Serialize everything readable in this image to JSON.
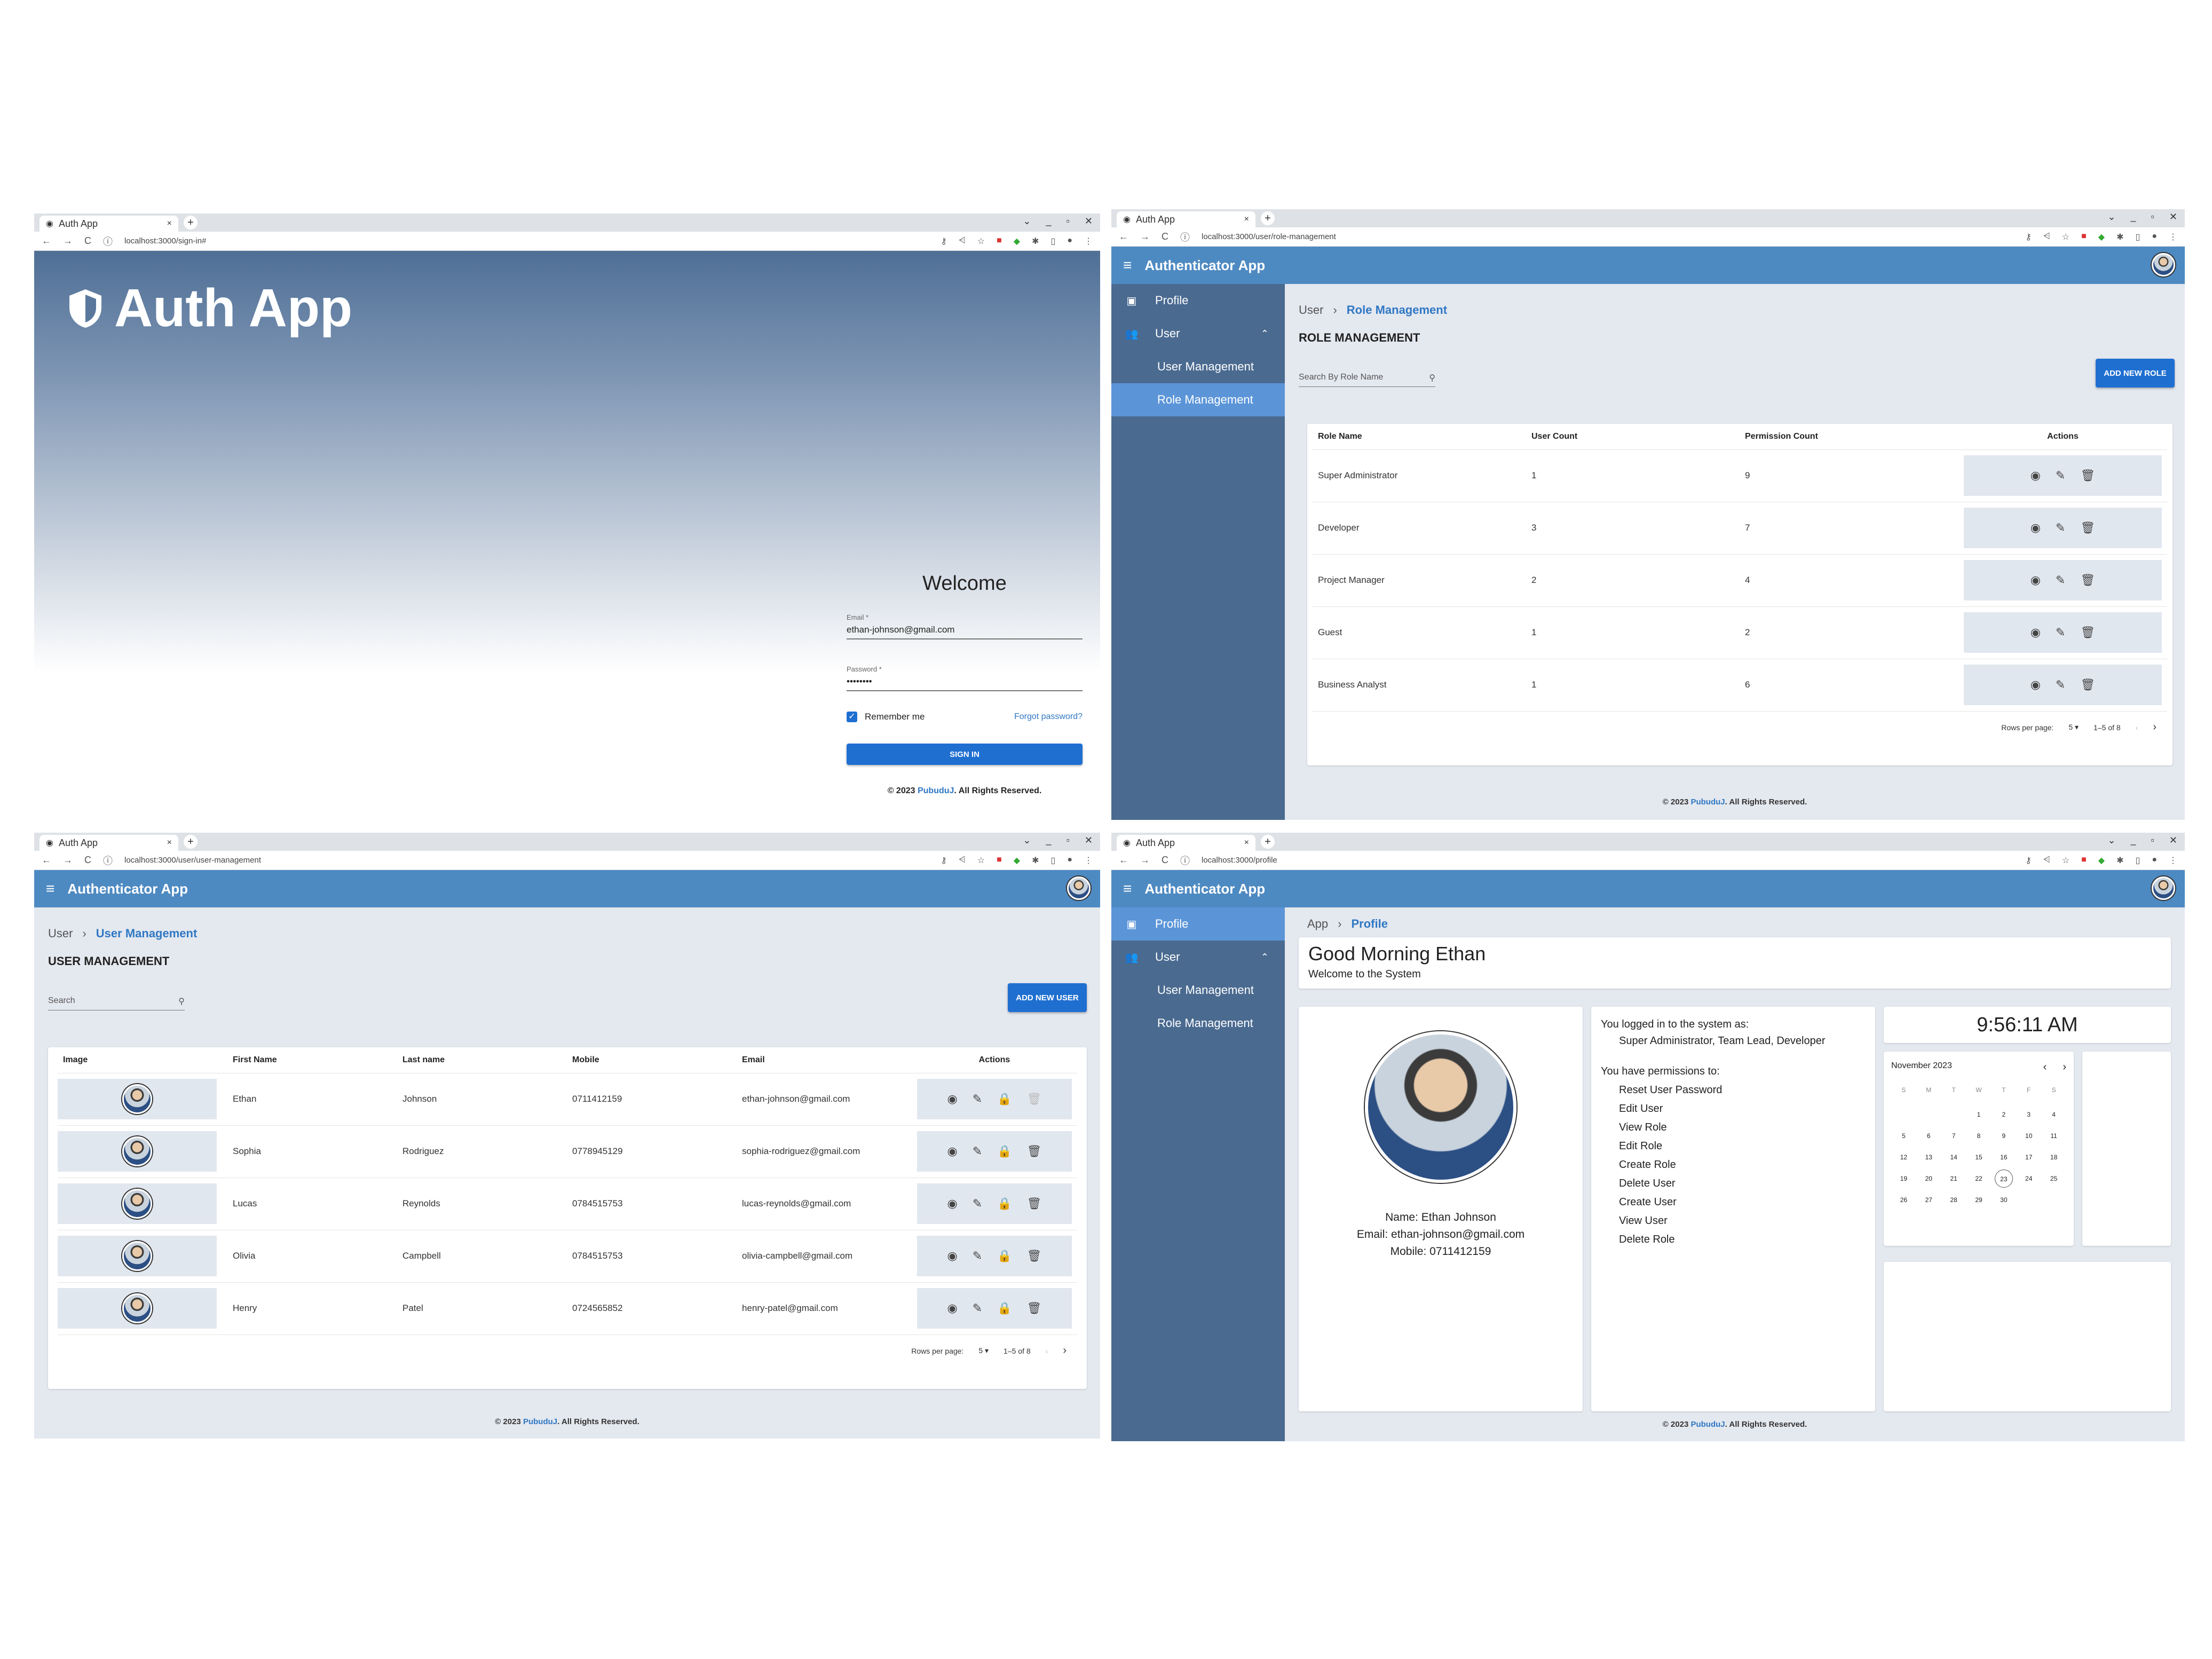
{
  "browser": {
    "tab_title": "Auth App",
    "new_tab": "+",
    "close": "×",
    "controls": [
      "⌄",
      "_",
      "▫",
      "✕"
    ],
    "back": "←",
    "forward": "→",
    "reload": "C",
    "info": "ⓘ"
  },
  "colors": {
    "appbar": "#4e8ac2",
    "sidebar": "#4a6a90",
    "sidebar_active": "#5b95d8",
    "primary_button": "#1f6fd1",
    "link": "#2f78c4"
  },
  "footer": {
    "pre": "© 2023 ",
    "link": "PubuduJ",
    "post": ". All Rights Reserved."
  },
  "signin": {
    "url": "localhost:3000/sign-in#",
    "brand": "Auth App",
    "welcome": "Welcome",
    "email_label": "Email *",
    "email_value": "ethan-johnson@gmail.com",
    "password_label": "Password *",
    "password_value": "••••••••",
    "remember_label": "Remember me",
    "remember_checked": true,
    "forgot": "Forgot password?",
    "submit": "SIGN IN"
  },
  "app": {
    "title": "Authenticator App",
    "menu_icon": "≡",
    "sidebar": {
      "profile": "Profile",
      "user": "User",
      "user_management": "User Management",
      "role_management": "Role Management"
    }
  },
  "roles_page": {
    "url": "localhost:3000/user/role-management",
    "crumb_parent": "User",
    "crumb_sep": "›",
    "crumb_current": "Role Management",
    "title": "ROLE MANAGEMENT",
    "search_placeholder": "Search By Role Name",
    "add_button": "ADD NEW ROLE",
    "columns": [
      "Role Name",
      "User Count",
      "Permission Count",
      "Actions"
    ],
    "rows": [
      {
        "name": "Super Administrator",
        "users": "1",
        "perms": "9"
      },
      {
        "name": "Developer",
        "users": "3",
        "perms": "7"
      },
      {
        "name": "Project Manager",
        "users": "2",
        "perms": "4"
      },
      {
        "name": "Guest",
        "users": "1",
        "perms": "2"
      },
      {
        "name": "Business Analyst",
        "users": "1",
        "perms": "6"
      }
    ],
    "rows_per_page_label": "Rows per page:",
    "rows_per_page": "5",
    "range": "1–5 of 8"
  },
  "users_page": {
    "url": "localhost:3000/user/user-management",
    "crumb_parent": "User",
    "crumb_sep": "›",
    "crumb_current": "User Management",
    "title": "USER MANAGEMENT",
    "search_placeholder": "Search",
    "add_button": "ADD NEW USER",
    "columns": [
      "Image",
      "First Name",
      "Last name",
      "Mobile",
      "Email",
      "Actions"
    ],
    "rows": [
      {
        "first": "Ethan",
        "last": "Johnson",
        "mobile": "0711412159",
        "email": "ethan-johnson@gmail.com"
      },
      {
        "first": "Sophia",
        "last": "Rodriguez",
        "mobile": "0778945129",
        "email": "sophia-rodriguez@gmail.com"
      },
      {
        "first": "Lucas",
        "last": "Reynolds",
        "mobile": "0784515753",
        "email": "lucas-reynolds@gmail.com"
      },
      {
        "first": "Olivia",
        "last": "Campbell",
        "mobile": "0784515753",
        "email": "olivia-campbell@gmail.com"
      },
      {
        "first": "Henry",
        "last": "Patel",
        "mobile": "0724565852",
        "email": "henry-patel@gmail.com"
      }
    ],
    "rows_per_page_label": "Rows per page:",
    "rows_per_page": "5",
    "range": "1–5 of 8"
  },
  "profile_page": {
    "url": "localhost:3000/profile",
    "crumb_parent": "App",
    "crumb_sep": "›",
    "crumb_current": "Profile",
    "greeting": "Good Morning Ethan",
    "welcome": "Welcome to the System",
    "name_line": "Name: Ethan Johnson",
    "email_line": "Email: ethan-johnson@gmail.com",
    "mobile_line": "Mobile: 0711412159",
    "logged_as_label": "You logged in to the system as:",
    "roles": "Super Administrator, Team Lead, Developer",
    "perm_label": "You have permissions to:",
    "permissions": [
      "Reset User Password",
      "Edit User",
      "View Role",
      "Edit Role",
      "Create Role",
      "Delete User",
      "Create User",
      "View User",
      "Delete Role"
    ],
    "clock": "9:56:11 AM",
    "calendar_month": "November 2023",
    "weekdays": [
      "S",
      "M",
      "T",
      "W",
      "T",
      "F",
      "S"
    ],
    "days": [
      "",
      "",
      "",
      "1",
      "2",
      "3",
      "4",
      "5",
      "6",
      "7",
      "8",
      "9",
      "10",
      "11",
      "12",
      "13",
      "14",
      "15",
      "16",
      "17",
      "18",
      "19",
      "20",
      "21",
      "22",
      "23",
      "24",
      "25",
      "26",
      "27",
      "28",
      "29",
      "30",
      "",
      ""
    ],
    "today": "23"
  }
}
